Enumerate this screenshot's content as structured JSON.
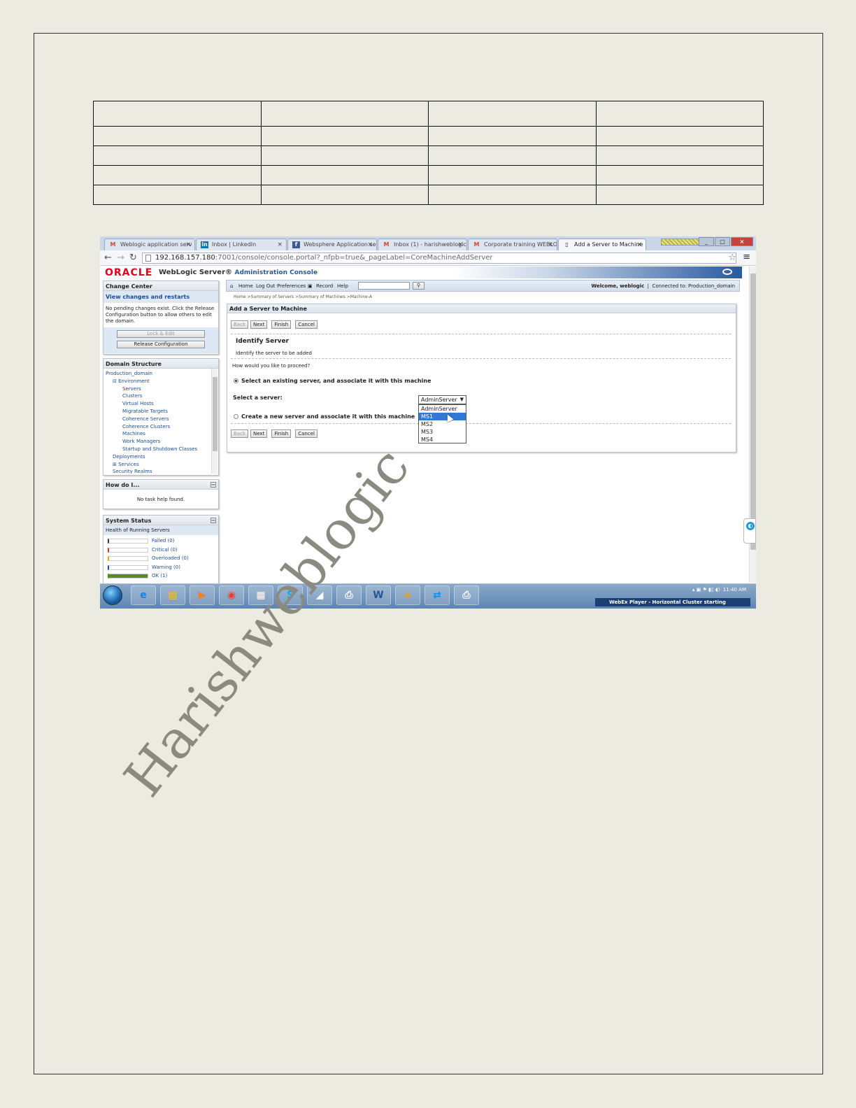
{
  "browser": {
    "tabs": [
      {
        "icon": "M",
        "icon_color": "#d44638",
        "label": "Weblogic application serv"
      },
      {
        "icon": "in",
        "icon_color": "#0e76a8",
        "label": "Inbox | LinkedIn"
      },
      {
        "icon": "f",
        "icon_color": "#3b5998",
        "label": "Websphere Application se"
      },
      {
        "icon": "M",
        "icon_color": "#d44638",
        "label": "Inbox (1) - harishweblogic"
      },
      {
        "icon": "M",
        "icon_color": "#d44638",
        "label": "Corporate training WEBLO"
      },
      {
        "icon": "",
        "icon_color": "#888888",
        "label": "Add a Server to Machine"
      }
    ],
    "url_host": "192.168.157.180",
    "url_rest": ":7001/console/console.portal?_nfpb=true&_pageLabel=CoreMachineAddServer"
  },
  "header": {
    "logo": "ORACLE",
    "product": "WebLogic Server®",
    "product_sub": "Administration Console"
  },
  "change_center": {
    "title": "Change Center",
    "link": "View changes and restarts",
    "text": "No pending changes exist. Click the Release Configuration button to allow others to edit the domain.",
    "lock_label": "Lock & Edit",
    "release_label": "Release Configuration"
  },
  "domain_structure": {
    "title": "Domain Structure",
    "root": "Production_domain",
    "items": [
      {
        "label": "⊟ Environment",
        "level": 1
      },
      {
        "label": "Servers",
        "level": 2
      },
      {
        "label": "Clusters",
        "level": 2
      },
      {
        "label": "Virtual Hosts",
        "level": 2
      },
      {
        "label": "Migratable Targets",
        "level": 2
      },
      {
        "label": "Coherence Servers",
        "level": 2
      },
      {
        "label": "Coherence Clusters",
        "level": 2
      },
      {
        "label": "Machines",
        "level": 2
      },
      {
        "label": "Work Managers",
        "level": 2
      },
      {
        "label": "Startup and Shutdown Classes",
        "level": 2
      },
      {
        "label": "Deployments",
        "level": 1
      },
      {
        "label": "⊞ Services",
        "level": 1
      },
      {
        "label": "Security Realms",
        "level": 1
      }
    ]
  },
  "how_do_i": {
    "title": "How do I...",
    "text": "No task help found."
  },
  "system_status": {
    "title": "System Status",
    "subtitle": "Health of Running Servers",
    "rows": [
      {
        "label": "Failed (0)",
        "color": "#333333",
        "fraction": 0
      },
      {
        "label": "Critical (0)",
        "color": "#d9302c",
        "fraction": 0
      },
      {
        "label": "Overloaded (0)",
        "color": "#f0a000",
        "fraction": 0
      },
      {
        "label": "Warning (0)",
        "color": "#1a4d99",
        "fraction": 0
      },
      {
        "label": "OK (1)",
        "color": "#5b8a1e",
        "fraction": 1
      }
    ]
  },
  "toolbar": {
    "home": "Home",
    "logout": "Log Out",
    "preferences": "Preferences",
    "record": "Record",
    "help": "Help",
    "welcome": "Welcome, weblogic",
    "connected": "Connected to: Production_domain"
  },
  "breadcrumb": "Home >Summary of Servers >Summary of Machines >Machine-A",
  "wizard": {
    "title": "Add a Server to Machine",
    "back": "Back",
    "next": "Next",
    "finish": "Finish",
    "cancel": "Cancel",
    "section_title": "Identify Server",
    "section_desc": "Identify the server to be added",
    "question": "How would you like to proceed?",
    "option_existing": "Select an existing server, and associate it with this machine",
    "select_label": "Select a server:",
    "selected_value": "AdminServer",
    "options": [
      "AdminServer",
      "MS1",
      "MS2",
      "MS3",
      "MS4"
    ],
    "highlighted_option": "MS1",
    "option_new": "Create a new server and associate it with this machine"
  },
  "taskbar": {
    "time": "11:40 AM",
    "webex": "WebEx Player - Horizontal Cluster starting"
  },
  "watermark": "Harishweblogic"
}
